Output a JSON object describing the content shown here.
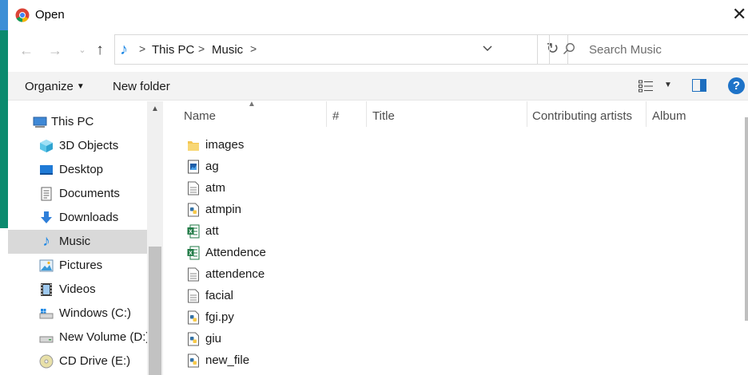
{
  "window": {
    "title": "Open",
    "close_glyph": "✕"
  },
  "nav_buttons": {
    "back": "←",
    "forward": "→",
    "recent": "⌄",
    "up": "↑"
  },
  "address": {
    "crumbs": [
      "This PC",
      "Music"
    ],
    "separator": ">",
    "dropdown": "⌄",
    "refresh": "↻"
  },
  "search": {
    "placeholder": "Search Music"
  },
  "toolbar": {
    "organize": "Organize",
    "organize_caret": "▼",
    "new_folder": "New folder",
    "view_caret": "▼",
    "help": "?"
  },
  "nav_pane": {
    "items": [
      {
        "label": "This PC",
        "icon": "computer-icon"
      },
      {
        "label": "3D Objects",
        "icon": "cube-icon"
      },
      {
        "label": "Desktop",
        "icon": "desktop-icon"
      },
      {
        "label": "Documents",
        "icon": "documents-icon"
      },
      {
        "label": "Downloads",
        "icon": "download-icon"
      },
      {
        "label": "Music",
        "icon": "music-icon",
        "selected": true
      },
      {
        "label": "Pictures",
        "icon": "pictures-icon"
      },
      {
        "label": "Videos",
        "icon": "videos-icon"
      },
      {
        "label": "Windows (C:)",
        "icon": "drive-icon"
      },
      {
        "label": "New Volume (D:)",
        "icon": "drive-icon"
      },
      {
        "label": "CD Drive (E:)",
        "icon": "cd-drive-icon"
      }
    ]
  },
  "columns": [
    "Name",
    "#",
    "Title",
    "Contributing artists",
    "Album"
  ],
  "files": [
    {
      "name": "images",
      "icon": "folder-icon"
    },
    {
      "name": "ag",
      "icon": "image-file-icon"
    },
    {
      "name": "atm",
      "icon": "text-file-icon"
    },
    {
      "name": "atmpin",
      "icon": "python-file-icon"
    },
    {
      "name": "att",
      "icon": "excel-file-icon"
    },
    {
      "name": "Attendence",
      "icon": "excel-file-icon"
    },
    {
      "name": "attendence",
      "icon": "text-file-icon"
    },
    {
      "name": "facial",
      "icon": "text-file-icon"
    },
    {
      "name": "fgi.py",
      "icon": "python-file-icon"
    },
    {
      "name": "giu",
      "icon": "python-file-icon"
    },
    {
      "name": "new_file",
      "icon": "python-file-icon"
    }
  ],
  "colors": {
    "accent": "#1e73c8",
    "selected_nav": "#d9d9d9",
    "toolbar_bg": "#f3f3f3"
  }
}
